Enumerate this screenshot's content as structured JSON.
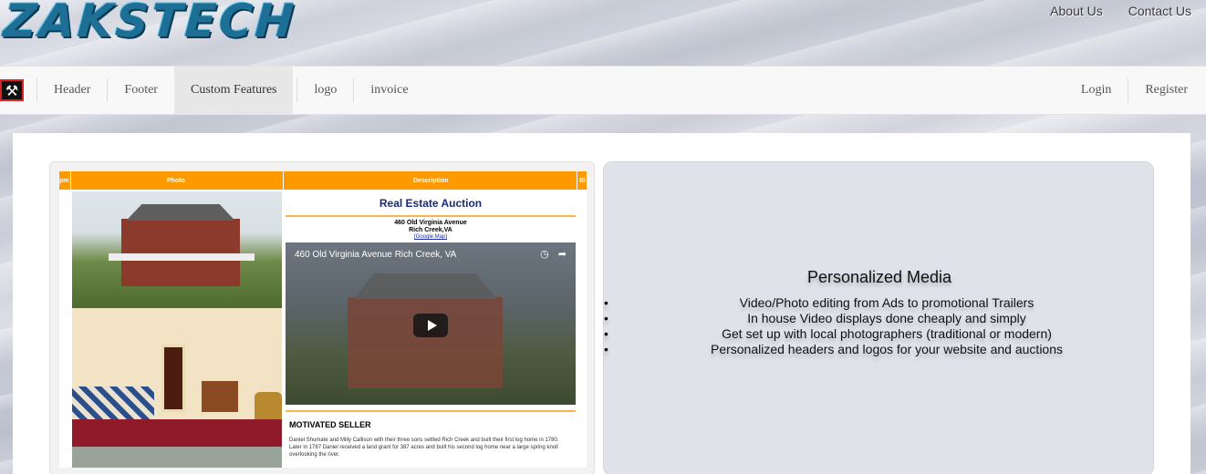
{
  "brand": {
    "name": "ZAKSTECH"
  },
  "top_links": {
    "about": "About Us",
    "contact": "Contact Us"
  },
  "navbar": {
    "logo_icon": "hammer-icon",
    "items": [
      "Header",
      "Footer",
      "Custom Features",
      "logo",
      "invoice"
    ],
    "active_index": 2,
    "right": {
      "login": "Login",
      "register": "Register"
    }
  },
  "listing": {
    "col_headers": {
      "left": "pm",
      "photo": "Photo",
      "description": "Description",
      "right": "Bi"
    },
    "title": "Real Estate Auction",
    "address_line1": "460 Old Virginia Avenue",
    "address_line2": "Rich Creek,VA",
    "map_link": "[Google Map]",
    "video_title": "460 Old Virginia Avenue Rich Creek, VA",
    "section_heading": "MOTIVATED SELLER",
    "body": "Daniel Shumate and Milly Callison with their three sons settled Rich Creek and built their first log home in 1780. Later in 1787 Daniel received a land grant for 387 acres and built his second log home near a large spring knoll overlooking the river."
  },
  "media": {
    "title": "Personalized Media",
    "items": [
      "Video/Photo editing from Ads to promotional Trailers",
      "In house Video displays done cheaply and simply",
      "Get set up with local photographers (traditional or modern)",
      "Personalized headers and logos for your website and auctions"
    ]
  }
}
